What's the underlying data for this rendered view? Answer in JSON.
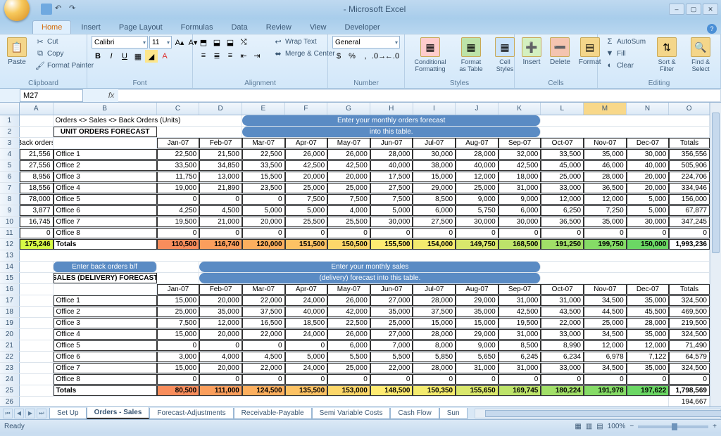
{
  "app": {
    "title": " - Microsoft Excel"
  },
  "ribbon": {
    "tabs": [
      "Home",
      "Insert",
      "Page Layout",
      "Formulas",
      "Data",
      "Review",
      "View",
      "Developer"
    ],
    "clipboard": {
      "paste": "Paste",
      "cut": "Cut",
      "copy": "Copy",
      "painter": "Format Painter",
      "label": "Clipboard"
    },
    "font": {
      "family": "Calibri",
      "size": "11",
      "label": "Font"
    },
    "alignment": {
      "wrap": "Wrap Text",
      "merge": "Merge & Center",
      "label": "Alignment"
    },
    "number": {
      "format": "General",
      "label": "Number"
    },
    "styles": {
      "cond": "Conditional Formatting",
      "table": "Format as Table",
      "cell": "Cell Styles",
      "label": "Styles"
    },
    "cells": {
      "insert": "Insert",
      "delete": "Delete",
      "format": "Format",
      "label": "Cells"
    },
    "editing": {
      "autosum": "AutoSum",
      "fill": "Fill",
      "clear": "Clear",
      "sort": "Sort & Filter",
      "find": "Find & Select",
      "label": "Editing"
    }
  },
  "namebox": "M27",
  "columns": [
    "A",
    "B",
    "C",
    "D",
    "E",
    "F",
    "G",
    "H",
    "I",
    "J",
    "K",
    "L",
    "M",
    "N",
    "O"
  ],
  "topline": "Orders <> Sales <> Back Orders (Units)",
  "section1": "UNIT ORDERS FORECAST",
  "prompt1a": "Enter your monthly  orders forecast",
  "prompt1b": "into this table.",
  "backorders_h": "Back orders",
  "months": [
    "Jan-07",
    "Feb-07",
    "Mar-07",
    "Apr-07",
    "May-07",
    "Jun-07",
    "Jul-07",
    "Aug-07",
    "Sep-07",
    "Oct-07",
    "Nov-07",
    "Dec-07"
  ],
  "totals_h": "Totals",
  "back_orders": [
    "21,556",
    "27,556",
    "8,956",
    "18,556",
    "78,000",
    "3,877",
    "16,745",
    "0"
  ],
  "back_total": "175,246",
  "offices": [
    "Office 1",
    "Office 2",
    "Office 3",
    "Office 4",
    "Office 5",
    "Office 6",
    "Office 7",
    "Office 8"
  ],
  "orders": [
    [
      "22,500",
      "21,500",
      "22,500",
      "26,000",
      "26,000",
      "28,000",
      "30,000",
      "28,000",
      "32,000",
      "33,500",
      "35,000",
      "30,000",
      "356,556"
    ],
    [
      "33,500",
      "34,850",
      "33,500",
      "42,500",
      "42,500",
      "40,000",
      "38,000",
      "40,000",
      "42,500",
      "45,000",
      "46,000",
      "40,000",
      "505,906"
    ],
    [
      "11,750",
      "13,000",
      "15,500",
      "20,000",
      "20,000",
      "17,500",
      "15,000",
      "12,000",
      "18,000",
      "25,000",
      "28,000",
      "20,000",
      "224,706"
    ],
    [
      "19,000",
      "21,890",
      "23,500",
      "25,000",
      "25,000",
      "27,500",
      "29,000",
      "25,000",
      "31,000",
      "33,000",
      "36,500",
      "20,000",
      "334,946"
    ],
    [
      "0",
      "0",
      "0",
      "7,500",
      "7,500",
      "7,500",
      "8,500",
      "9,000",
      "9,000",
      "12,000",
      "12,000",
      "5,000",
      "156,000"
    ],
    [
      "4,250",
      "4,500",
      "5,000",
      "5,000",
      "4,000",
      "5,000",
      "6,000",
      "5,750",
      "6,000",
      "6,250",
      "7,250",
      "5,000",
      "67,877"
    ],
    [
      "19,500",
      "21,000",
      "20,000",
      "25,500",
      "25,500",
      "30,000",
      "27,500",
      "30,000",
      "30,000",
      "36,500",
      "35,000",
      "30,000",
      "347,245"
    ],
    [
      "0",
      "0",
      "0",
      "0",
      "0",
      "0",
      "0",
      "0",
      "0",
      "0",
      "0",
      "0",
      "0"
    ]
  ],
  "orders_totals": [
    "110,500",
    "116,740",
    "120,000",
    "151,500",
    "150,500",
    "155,500",
    "154,000",
    "149,750",
    "168,500",
    "191,250",
    "199,750",
    "150,000",
    "1,993,236"
  ],
  "totals_label": "Totals",
  "btn_back": "Enter back orders b/f",
  "prompt2a": "Enter your monthly sales",
  "prompt2b": "(delivery) forecast into this table.",
  "section2": "SALES (DELIVERY) FORECAST",
  "sales": [
    [
      "15,000",
      "20,000",
      "22,000",
      "24,000",
      "26,000",
      "27,000",
      "28,000",
      "29,000",
      "31,000",
      "31,000",
      "34,500",
      "35,000",
      "324,500"
    ],
    [
      "25,000",
      "35,000",
      "37,500",
      "40,000",
      "42,000",
      "35,000",
      "37,500",
      "35,000",
      "42,500",
      "43,500",
      "44,500",
      "45,500",
      "469,500"
    ],
    [
      "7,500",
      "12,000",
      "16,500",
      "18,500",
      "22,500",
      "25,000",
      "15,000",
      "15,000",
      "19,500",
      "22,000",
      "25,000",
      "28,000",
      "219,500"
    ],
    [
      "15,000",
      "20,000",
      "22,000",
      "24,000",
      "26,000",
      "27,000",
      "28,000",
      "29,000",
      "31,000",
      "33,000",
      "34,500",
      "35,000",
      "324,500"
    ],
    [
      "0",
      "0",
      "0",
      "0",
      "6,000",
      "7,000",
      "8,000",
      "9,000",
      "8,500",
      "8,990",
      "12,000",
      "12,000",
      "71,490"
    ],
    [
      "3,000",
      "4,000",
      "4,500",
      "5,000",
      "5,500",
      "5,500",
      "5,850",
      "5,650",
      "6,245",
      "6,234",
      "6,978",
      "7,122",
      "64,579"
    ],
    [
      "15,000",
      "20,000",
      "22,000",
      "24,000",
      "25,000",
      "22,000",
      "28,000",
      "31,000",
      "31,000",
      "33,000",
      "34,500",
      "35,000",
      "324,500"
    ],
    [
      "0",
      "0",
      "0",
      "0",
      "0",
      "0",
      "0",
      "0",
      "0",
      "0",
      "0",
      "0",
      "0"
    ]
  ],
  "sales_totals": [
    "80,500",
    "111,000",
    "124,500",
    "135,500",
    "153,000",
    "148,500",
    "150,350",
    "155,650",
    "169,745",
    "180,224",
    "191,978",
    "197,622",
    "1,798,569"
  ],
  "trailing": "194,667",
  "sheets": [
    "Set Up",
    "Orders - Sales",
    "Forecast-Adjustments",
    "Receivable-Payable",
    "Semi Variable Costs",
    "Cash Flow",
    "Sun"
  ],
  "status": {
    "ready": "Ready",
    "zoom": "100%"
  }
}
